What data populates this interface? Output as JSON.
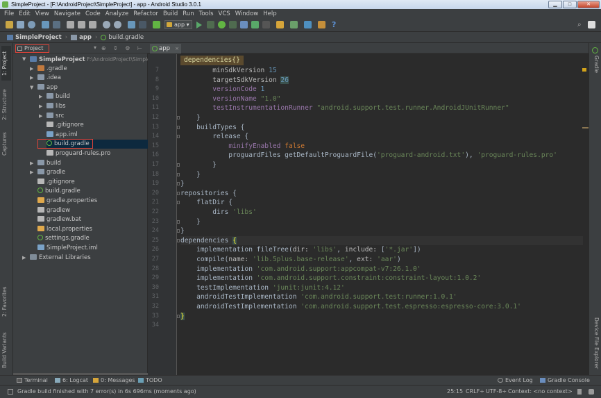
{
  "window": {
    "title": "SimpleProject - [F:\\AndroidProject\\SimpleProject] - app - Android Studio 3.0.1"
  },
  "menu": [
    "File",
    "Edit",
    "View",
    "Navigate",
    "Code",
    "Analyze",
    "Refactor",
    "Build",
    "Run",
    "Tools",
    "VCS",
    "Window",
    "Help"
  ],
  "toolbar": {
    "run_config": "app"
  },
  "breadcrumbs": [
    "SimpleProject",
    "app",
    "build.gradle"
  ],
  "left_tabs": [
    "1: Project",
    "2: Structure",
    "Captures",
    "2: Favorites",
    "Build Variants"
  ],
  "right_tabs": [
    "Gradle",
    "Device File Explorer"
  ],
  "project_panel": {
    "view_label": "Project"
  },
  "tree": [
    {
      "label": "SimpleProject",
      "extra": "F:\\AndroidProject\\SimplePro",
      "indent": 0,
      "arrow": "▼",
      "icon": "root"
    },
    {
      "label": ".gradle",
      "indent": 1,
      "arrow": "▶",
      "icon": "folder-o"
    },
    {
      "label": ".idea",
      "indent": 1,
      "arrow": "▶",
      "icon": "folder"
    },
    {
      "label": "app",
      "indent": 1,
      "arrow": "▼",
      "icon": "folder"
    },
    {
      "label": "build",
      "indent": 2,
      "arrow": "▶",
      "icon": "folder"
    },
    {
      "label": "libs",
      "indent": 2,
      "arrow": "▶",
      "icon": "folder"
    },
    {
      "label": "src",
      "indent": 2,
      "arrow": "▶",
      "icon": "folder"
    },
    {
      "label": ".gitignore",
      "indent": 2,
      "arrow": "",
      "icon": "gfile"
    },
    {
      "label": "app.iml",
      "indent": 2,
      "arrow": "",
      "icon": "imlf"
    },
    {
      "label": "build.gradle",
      "indent": 2,
      "arrow": "",
      "icon": "gradle",
      "selected": true
    },
    {
      "label": "proguard-rules.pro",
      "indent": 2,
      "arrow": "",
      "icon": "gfile"
    },
    {
      "label": "build",
      "indent": 1,
      "arrow": "▶",
      "icon": "folder"
    },
    {
      "label": "gradle",
      "indent": 1,
      "arrow": "▶",
      "icon": "folder"
    },
    {
      "label": ".gitignore",
      "indent": 1,
      "arrow": "",
      "icon": "gfile"
    },
    {
      "label": "build.gradle",
      "indent": 1,
      "arrow": "",
      "icon": "gradle"
    },
    {
      "label": "gradle.properties",
      "indent": 1,
      "arrow": "",
      "icon": "xml"
    },
    {
      "label": "gradlew",
      "indent": 1,
      "arrow": "",
      "icon": "gfile"
    },
    {
      "label": "gradlew.bat",
      "indent": 1,
      "arrow": "",
      "icon": "gfile"
    },
    {
      "label": "local.properties",
      "indent": 1,
      "arrow": "",
      "icon": "xml"
    },
    {
      "label": "settings.gradle",
      "indent": 1,
      "arrow": "",
      "icon": "gradle"
    },
    {
      "label": "SimpleProject.iml",
      "indent": 1,
      "arrow": "",
      "icon": "imlf"
    },
    {
      "label": "External Libraries",
      "indent": 0,
      "arrow": "▶",
      "icon": "lib"
    }
  ],
  "editor": {
    "tab_label": "app",
    "crumb": "dependencies{}",
    "lines": [
      {
        "n": "7",
        "html": "        <span class='param'>minSdkVersion</span> <span class='num'>15</span>"
      },
      {
        "n": "8",
        "html": "        <span class='param'>targetSdkVersion</span> <span class='num hlnum'>26</span>"
      },
      {
        "n": "9",
        "html": "        <span class='prop'>versionCode</span> <span class='num'>1</span>"
      },
      {
        "n": "10",
        "html": "        <span class='prop'>versionName</span> <span class='str'>\"1.0\"</span>"
      },
      {
        "n": "11",
        "html": "        <span class='prop'>testInstrumentationRunner</span> <span class='str'>\"android.support.test.runner.AndroidJUnitRunner\"</span>"
      },
      {
        "n": "12",
        "html": "    }"
      },
      {
        "n": "13",
        "html": "    buildTypes {"
      },
      {
        "n": "14",
        "html": "        release {"
      },
      {
        "n": "15",
        "html": "            <span class='prop'>minifyEnabled</span> <span class='kw'>false</span>"
      },
      {
        "n": "16",
        "html": "            proguardFiles getDefaultProguardFile(<span class='str'>'proguard-android.txt'</span>), <span class='str'>'proguard-rules.pro'</span>"
      },
      {
        "n": "17",
        "html": "        }"
      },
      {
        "n": "18",
        "html": "    }"
      },
      {
        "n": "19",
        "html": "}"
      },
      {
        "n": "20",
        "html": "repositories {"
      },
      {
        "n": "21",
        "html": "    flatDir {"
      },
      {
        "n": "22",
        "html": "        dirs <span class='str'>'libs'</span>"
      },
      {
        "n": "23",
        "html": "    }"
      },
      {
        "n": "24",
        "html": "}"
      },
      {
        "n": "25",
        "html": "dependencies <span class='brace'>{</span>"
      },
      {
        "n": "26",
        "html": "    implementation fileTree(<span class='param'>dir:</span> <span class='str'>'libs'</span>, <span class='param'>include:</span> [<span class='str'>'*.jar'</span>])"
      },
      {
        "n": "27",
        "html": "    compile(<span class='param'>name:</span> <span class='str'>'lib.5plus.base-release'</span>, <span class='param'>ext:</span> <span class='str'>'aar'</span>)"
      },
      {
        "n": "28",
        "html": "    implementation <span class='str'>'com.android.support:appcompat-v7:26.1.0'</span>"
      },
      {
        "n": "29",
        "html": "    implementation <span class='str'>'com.android.support.constraint:constraint-layout:1.0.2'</span>"
      },
      {
        "n": "30",
        "html": "    testImplementation <span class='str'>'junit:junit:4.12'</span>"
      },
      {
        "n": "31",
        "html": "    androidTestImplementation <span class='str'>'com.android.support.test:runner:1.0.1'</span>"
      },
      {
        "n": "32",
        "html": "    androidTestImplementation <span class='str'>'com.android.support.test.espresso:espresso-core:3.0.1'</span>"
      },
      {
        "n": "33",
        "html": "<span class='brace'>}</span>"
      },
      {
        "n": "34",
        "html": ""
      }
    ]
  },
  "bottom_tabs": [
    "Terminal",
    "6: Logcat",
    "0: Messages",
    "TODO"
  ],
  "bottom_right": [
    "Event Log",
    "Gradle Console"
  ],
  "status": {
    "message": "Gradle build finished with 7 error(s) in 6s 696ms (moments ago)",
    "position": "25:15",
    "line_sep": "CRLF÷",
    "encoding": "UTF-8÷",
    "context": "Context: <no context>"
  },
  "colors": {
    "accent_red": "#e0443a",
    "gradle_green": "#62b543"
  }
}
